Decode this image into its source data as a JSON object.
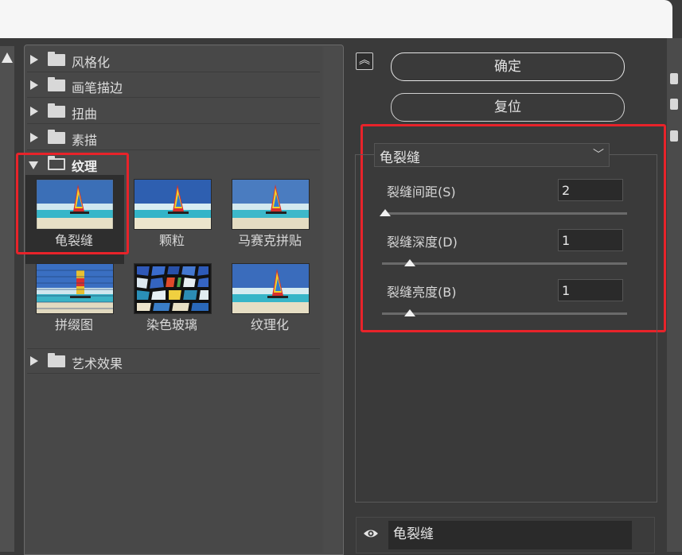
{
  "categories": [
    {
      "label": "风格化",
      "expanded": false
    },
    {
      "label": "画笔描边",
      "expanded": false
    },
    {
      "label": "扭曲",
      "expanded": false
    },
    {
      "label": "素描",
      "expanded": false
    },
    {
      "label": "纹理",
      "expanded": true
    },
    {
      "label": "艺术效果",
      "expanded": false
    }
  ],
  "texture_filters": [
    {
      "label": "龟裂缝",
      "selected": true
    },
    {
      "label": "颗粒",
      "selected": false
    },
    {
      "label": "马赛克拼贴",
      "selected": false
    },
    {
      "label": "拼缀图",
      "selected": false
    },
    {
      "label": "染色玻璃",
      "selected": false
    },
    {
      "label": "纹理化",
      "selected": false
    }
  ],
  "buttons": {
    "ok": "确定",
    "reset": "复位",
    "collapse_icon": "chevron-double-up-icon"
  },
  "settings": {
    "filter_select": "龟裂缝",
    "params": [
      {
        "label": "裂缝间距(S)",
        "value": "2",
        "slider_fraction": 0.02
      },
      {
        "label": "裂缝深度(D)",
        "value": "1",
        "slider_fraction": 0.1
      },
      {
        "label": "裂缝亮度(B)",
        "value": "1",
        "slider_fraction": 0.1
      }
    ]
  },
  "layer": {
    "name": "龟裂缝",
    "visibility_icon": "eye-icon"
  },
  "colors": {
    "highlight_box": "#e8232a",
    "panel_bg": "#484848"
  }
}
